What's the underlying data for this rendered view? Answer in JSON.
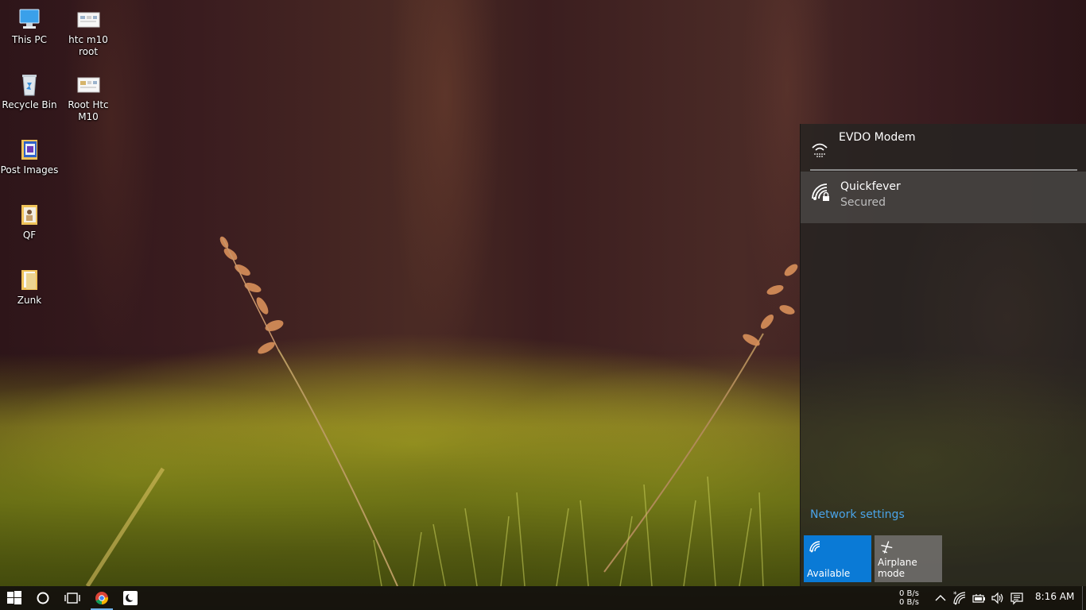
{
  "desktop": {
    "icons": [
      {
        "label": "This PC"
      },
      {
        "label": "htc m10 root"
      },
      {
        "label": "Recycle Bin"
      },
      {
        "label": "Root Htc M10"
      },
      {
        "label": "Post Images"
      },
      {
        "label": "QF"
      },
      {
        "label": "Zunk"
      }
    ]
  },
  "network_flyout": {
    "connections": [
      {
        "name": "EVDO Modem",
        "status": ""
      },
      {
        "name": "Quickfever",
        "status": "Secured"
      }
    ],
    "settings_link": "Network settings",
    "tiles": [
      {
        "label": "Available",
        "icon": "wifi-icon",
        "active": true,
        "color": "#0a7ad6"
      },
      {
        "label": "Airplane mode",
        "icon": "airplane-icon",
        "active": false
      }
    ]
  },
  "taskbar": {
    "net_speed_up": "0 B/s",
    "net_speed_down": "0 B/s",
    "time": "8:16 AM",
    "pinned": [
      "start-icon",
      "cortana-icon",
      "task-view-icon",
      "chrome-icon",
      "moon-app-icon"
    ],
    "tray": [
      "chevron-up-icon",
      "wifi-icon",
      "battery-icon",
      "volume-icon",
      "action-center-icon"
    ]
  },
  "colors": {
    "accent": "#0a7ad6",
    "link": "#4aa3e8"
  }
}
